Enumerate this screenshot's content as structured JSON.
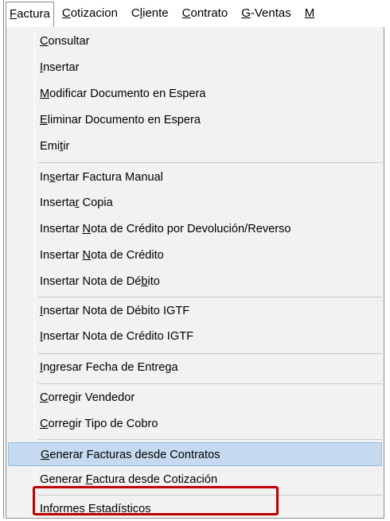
{
  "menubar": {
    "items": [
      {
        "pre": "",
        "mn": "F",
        "post": "actura"
      },
      {
        "pre": "",
        "mn": "C",
        "post": "otizacion"
      },
      {
        "pre": "C",
        "mn": "l",
        "post": "iente"
      },
      {
        "pre": "",
        "mn": "C",
        "post": "ontrato"
      },
      {
        "pre": "",
        "mn": "G",
        "post": "-Ventas"
      },
      {
        "pre": "",
        "mn": "M",
        "post": ""
      }
    ]
  },
  "menu": {
    "items": [
      {
        "pre": "",
        "mn": "C",
        "post": "onsultar"
      },
      {
        "pre": "",
        "mn": "I",
        "post": "nsertar"
      },
      {
        "pre": "",
        "mn": "M",
        "post": "odificar Documento en Espera"
      },
      {
        "pre": "",
        "mn": "E",
        "post": "liminar Documento en Espera"
      },
      {
        "pre": "Emi",
        "mn": "t",
        "post": "ir"
      },
      {
        "pre": "In",
        "mn": "s",
        "post": "ertar Factura Manual"
      },
      {
        "pre": "Inserta",
        "mn": "r",
        "post": " Copia"
      },
      {
        "pre": "Insertar ",
        "mn": "N",
        "post": "ota de Crédito por Devolución/Reverso"
      },
      {
        "pre": "Insertar ",
        "mn": "N",
        "post": "ota de Crédito"
      },
      {
        "pre": "Insertar Nota de Dé",
        "mn": "b",
        "post": "ito"
      },
      {
        "pre": "",
        "mn": "I",
        "post": "nsertar Nota de Débito IGTF"
      },
      {
        "pre": "",
        "mn": "I",
        "post": "nsertar Nota de Crédito IGTF"
      },
      {
        "pre": "",
        "mn": "I",
        "post": "ngresar Fecha de Entrega"
      },
      {
        "pre": "",
        "mn": "C",
        "post": "orregir Vendedor"
      },
      {
        "pre": "",
        "mn": "C",
        "post": "orregir Tipo de Cobro"
      },
      {
        "pre": "",
        "mn": "G",
        "post": "enerar Facturas desde Contratos"
      },
      {
        "pre": "Generar ",
        "mn": "F",
        "post": "actura desde Cotización"
      },
      {
        "pre": "Informe",
        "mn": "s",
        "post": " Estadísticos"
      }
    ]
  },
  "highlight_color": "#c5daf0",
  "annotation_color": "#c00000"
}
